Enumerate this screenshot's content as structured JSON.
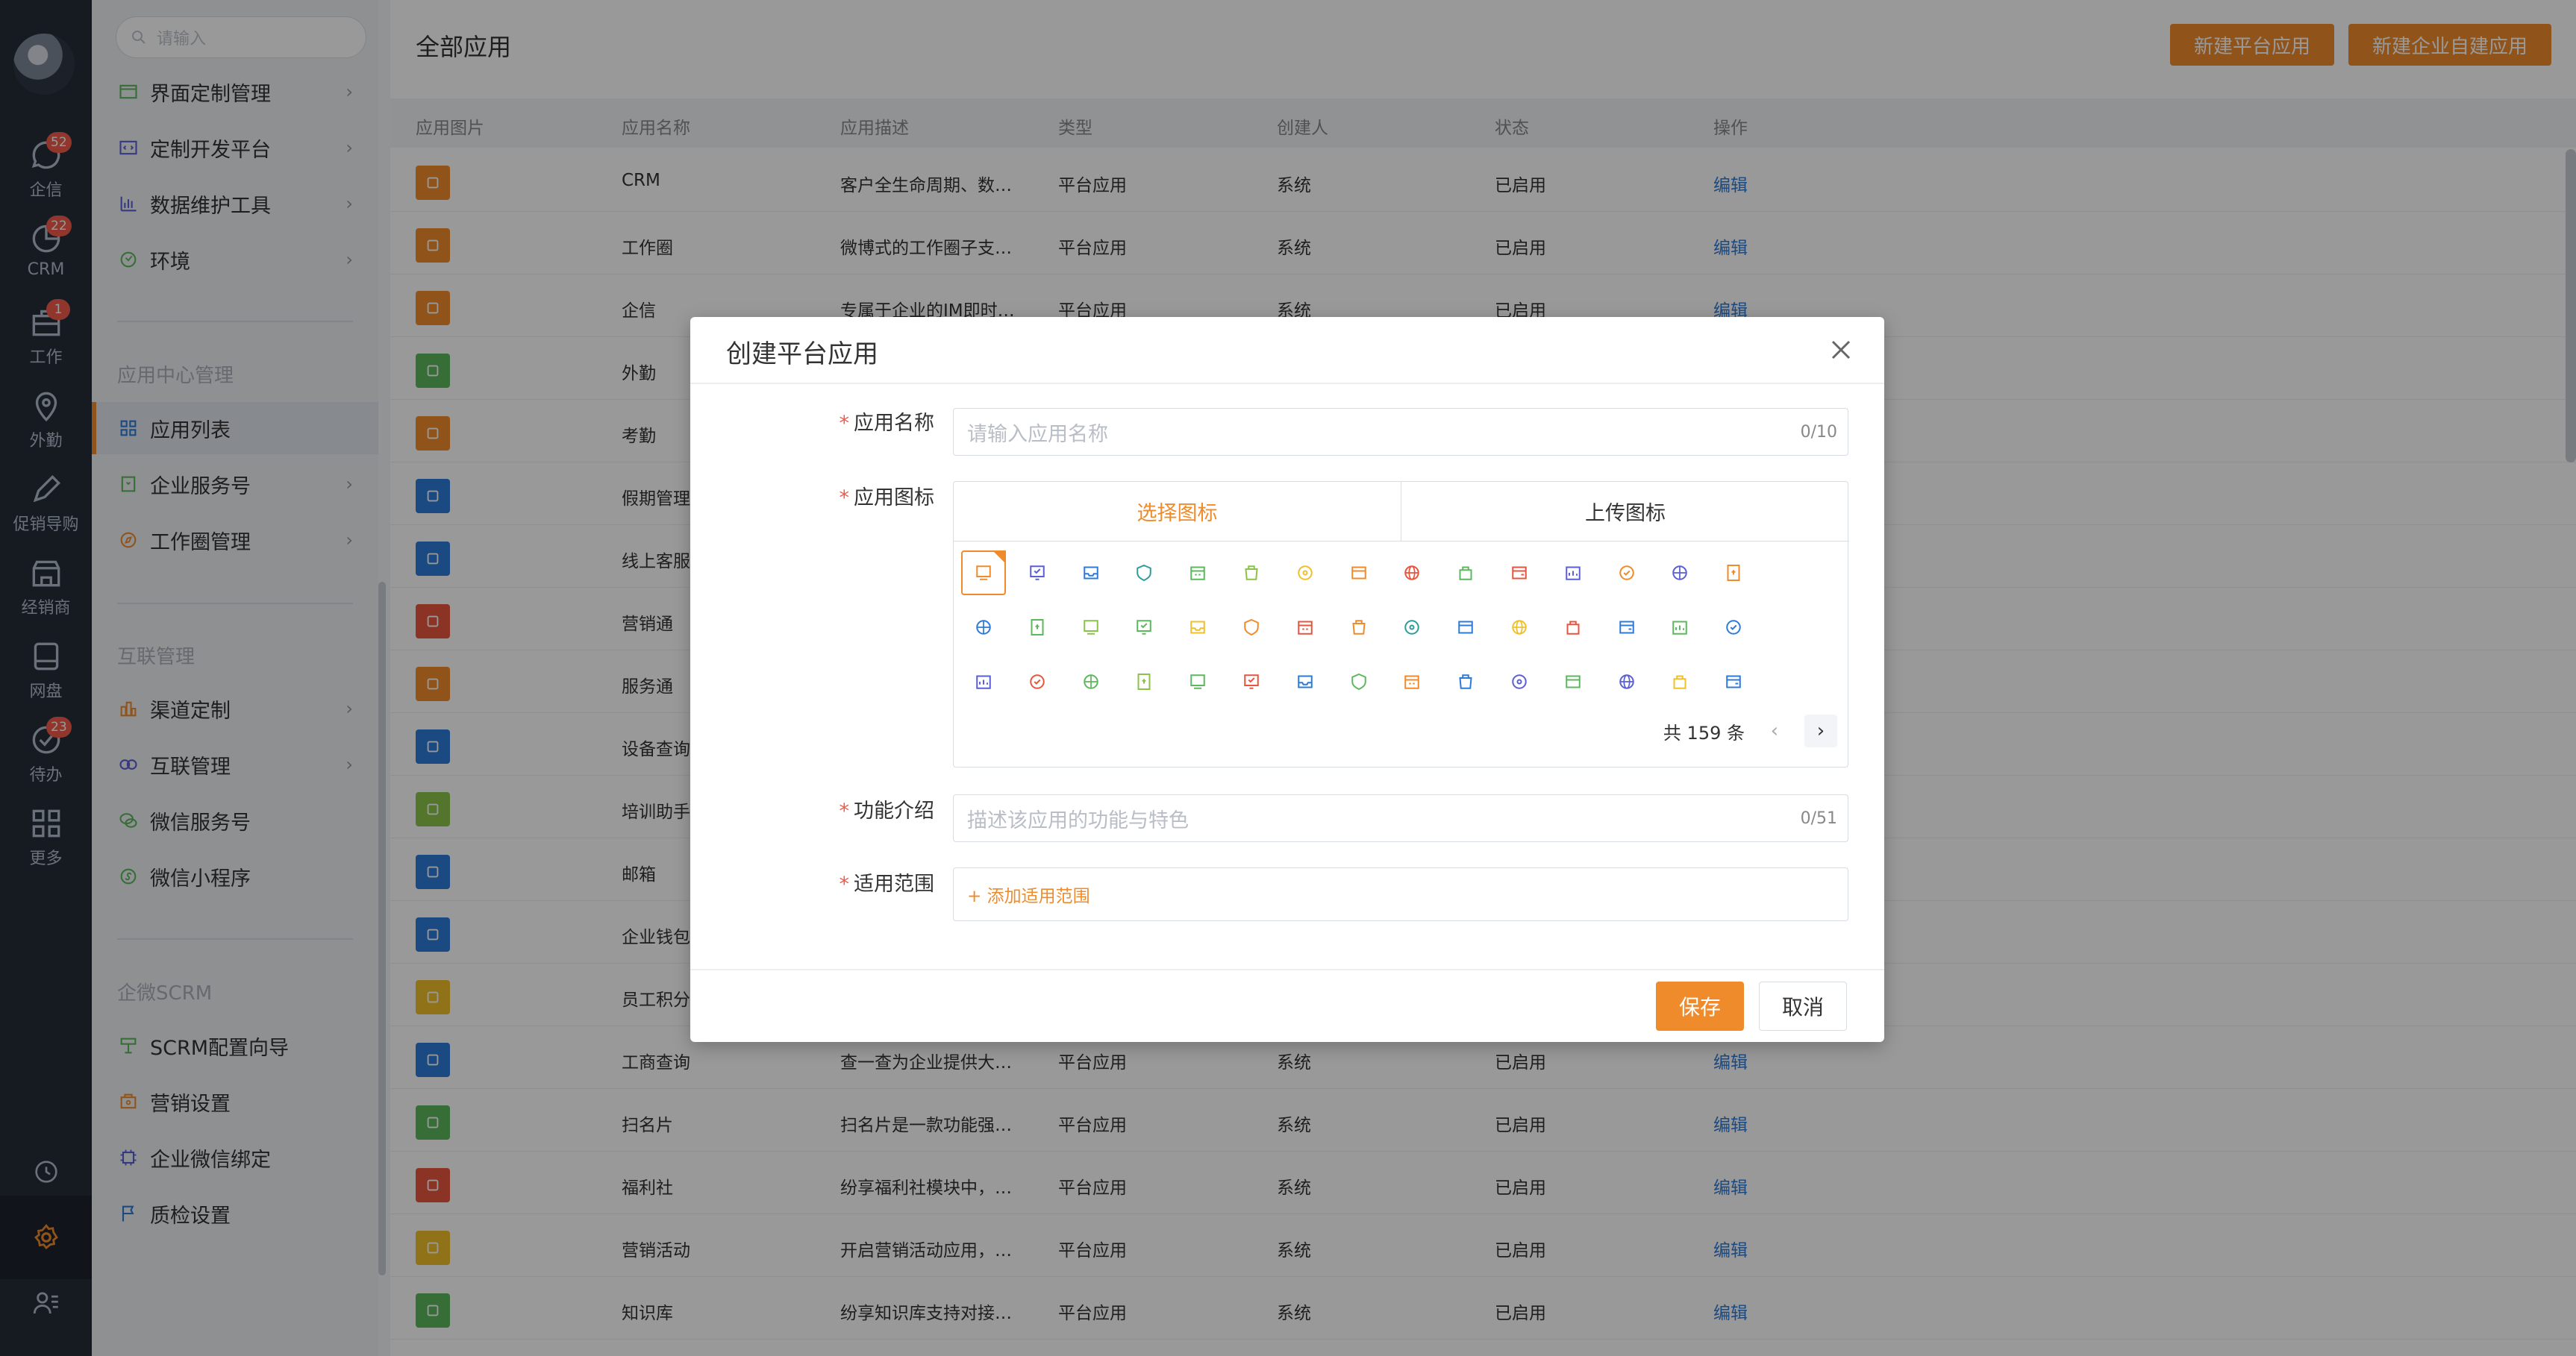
{
  "rail": {
    "items": [
      {
        "label": "企信",
        "badge": "52",
        "icon": "chat-icon"
      },
      {
        "label": "CRM",
        "badge": "22",
        "icon": "pie-icon"
      },
      {
        "label": "工作",
        "badge": "1",
        "icon": "briefcase-icon"
      },
      {
        "label": "外勤",
        "badge": "",
        "icon": "location-icon"
      },
      {
        "label": "促销导购",
        "badge": "",
        "icon": "pencil-icon"
      },
      {
        "label": "经销商",
        "badge": "",
        "icon": "store-icon"
      },
      {
        "label": "网盘",
        "badge": "",
        "icon": "disk-icon"
      },
      {
        "label": "待办",
        "badge": "23",
        "icon": "check-circle-icon"
      },
      {
        "label": "更多",
        "badge": "",
        "icon": "grid-icon"
      }
    ]
  },
  "sidebar": {
    "search_placeholder": "请输入",
    "group1": [
      {
        "label": "界面定制管理",
        "icon": "window-icon",
        "has_children": true
      },
      {
        "label": "定制开发平台",
        "icon": "code-icon",
        "has_children": true
      },
      {
        "label": "数据维护工具",
        "icon": "bar-chart-icon",
        "has_children": true
      },
      {
        "label": "环境",
        "icon": "environment-icon",
        "has_children": true
      }
    ],
    "section2": "应用中心管理",
    "group2": [
      {
        "label": "应用列表",
        "icon": "apps-icon",
        "has_children": false,
        "active": true
      },
      {
        "label": "企业服务号",
        "icon": "service-icon",
        "has_children": true
      },
      {
        "label": "工作圈管理",
        "icon": "compass-icon",
        "has_children": true
      }
    ],
    "section3": "互联管理",
    "group3": [
      {
        "label": "渠道定制",
        "icon": "channel-icon",
        "has_children": true
      },
      {
        "label": "互联管理",
        "icon": "link-icon",
        "has_children": true
      },
      {
        "label": "微信服务号",
        "icon": "wechat-icon",
        "has_children": false
      },
      {
        "label": "微信小程序",
        "icon": "miniprogram-icon",
        "has_children": false
      }
    ],
    "section4": "企微SCRM",
    "group4": [
      {
        "label": "SCRM配置向导",
        "icon": "guide-icon"
      },
      {
        "label": "营销设置",
        "icon": "marketing-icon"
      },
      {
        "label": "企业微信绑定",
        "icon": "chip-icon"
      },
      {
        "label": "质检设置",
        "icon": "flag-icon"
      }
    ],
    "collapse_glyph": "«"
  },
  "main": {
    "title": "全部应用",
    "btn_new_platform": "新建平台应用",
    "btn_new_enterprise": "新建企业自建应用",
    "columns": [
      "应用图片",
      "应用名称",
      "应用描述",
      "类型",
      "创建人",
      "状态",
      "操作"
    ],
    "rows": [
      {
        "name": "CRM",
        "desc": "客户全生命周期、数…",
        "type": "平台应用",
        "creator": "系统",
        "status": "已启用",
        "action": "编辑",
        "color": "#f08b2b"
      },
      {
        "name": "工作圈",
        "desc": "微博式的工作圈子支…",
        "type": "平台应用",
        "creator": "系统",
        "status": "已启用",
        "action": "编辑",
        "color": "#f08b2b"
      },
      {
        "name": "企信",
        "desc": "专属于企业的IM即时…",
        "type": "平台应用",
        "creator": "系统",
        "status": "已启用",
        "action": "编辑",
        "color": "#f08b2b"
      },
      {
        "name": "外勤",
        "desc": "",
        "type": "",
        "creator": "",
        "status": "",
        "action": "",
        "color": "#5cb85c"
      },
      {
        "name": "考勤",
        "desc": "",
        "type": "",
        "creator": "",
        "status": "",
        "action": "",
        "color": "#f08b2b"
      },
      {
        "name": "假期管理",
        "desc": "",
        "type": "",
        "creator": "",
        "status": "",
        "action": "",
        "color": "#2d7bd9"
      },
      {
        "name": "线上客服",
        "desc": "",
        "type": "",
        "creator": "",
        "status": "",
        "action": "",
        "color": "#2d7bd9"
      },
      {
        "name": "营销通",
        "desc": "",
        "type": "",
        "creator": "",
        "status": "",
        "action": "",
        "color": "#e8553e"
      },
      {
        "name": "服务通",
        "desc": "",
        "type": "",
        "creator": "",
        "status": "",
        "action": "",
        "color": "#f08b2b"
      },
      {
        "name": "设备查询",
        "desc": "",
        "type": "",
        "creator": "",
        "status": "",
        "action": "",
        "color": "#2d7bd9"
      },
      {
        "name": "培训助手",
        "desc": "",
        "type": "",
        "creator": "",
        "status": "",
        "action": "",
        "color": "#8bc34a"
      },
      {
        "name": "邮箱",
        "desc": "",
        "type": "",
        "creator": "",
        "status": "",
        "action": "",
        "color": "#2d7bd9"
      },
      {
        "name": "企业钱包",
        "desc": "",
        "type": "",
        "creator": "",
        "status": "",
        "action": "",
        "color": "#2d7bd9"
      },
      {
        "name": "员工积分",
        "desc": "",
        "type": "",
        "creator": "",
        "status": "",
        "action": "",
        "color": "#f0c02b"
      },
      {
        "name": "工商查询",
        "desc": "查一查为企业提供大…",
        "type": "平台应用",
        "creator": "系统",
        "status": "已启用",
        "action": "编辑",
        "color": "#2d7bd9"
      },
      {
        "name": "扫名片",
        "desc": "扫名片是一款功能强…",
        "type": "平台应用",
        "creator": "系统",
        "status": "已启用",
        "action": "编辑",
        "color": "#5cb85c"
      },
      {
        "name": "福利社",
        "desc": "纷享福利社模块中，…",
        "type": "平台应用",
        "creator": "系统",
        "status": "已启用",
        "action": "编辑",
        "color": "#e8553e"
      },
      {
        "name": "营销活动",
        "desc": "开启营销活动应用，…",
        "type": "平台应用",
        "creator": "系统",
        "status": "已启用",
        "action": "编辑",
        "color": "#f0c02b"
      },
      {
        "name": "知识库",
        "desc": "纷享知识库支持对接…",
        "type": "平台应用",
        "creator": "系统",
        "status": "已启用",
        "action": "编辑",
        "color": "#5cb85c"
      }
    ]
  },
  "modal": {
    "title": "创建平台应用",
    "name_label": "应用名称",
    "name_placeholder": "请输入应用名称",
    "name_count": "0/10",
    "icon_label": "应用图标",
    "tab_choose": "选择图标",
    "tab_upload": "上传图标",
    "total_text": "共 159 条",
    "prev_glyph": "‹",
    "next_glyph": "›",
    "intro_label": "功能介绍",
    "intro_placeholder": "描述该应用的功能与特色",
    "intro_count": "0/51",
    "scope_label": "适用范围",
    "scope_add": "+ 添加适用范围",
    "save": "保存",
    "cancel": "取消",
    "icon_colors": [
      "#f08b2b",
      "#5b5fd6",
      "#2d7bd9",
      "#2d9c9c",
      "#5cb85c",
      "#8bc34a",
      "#f0c02b",
      "#f08b2b",
      "#e8553e",
      "#5cb85c",
      "#e8553e",
      "#5b5fd6",
      "#f08b2b",
      "#5b5fd6",
      "#f08b2b",
      "#2d7bd9",
      "#5cb85c",
      "#8bc34a",
      "#5cb85c",
      "#f0c02b",
      "#f08b2b",
      "#e8553e",
      "#f08b2b",
      "#2d9c9c",
      "#2d7bd9",
      "#f0c02b",
      "#e8553e",
      "#2d7bd9",
      "#5cb85c",
      "#2d7bd9",
      "#5b5fd6",
      "#e8553e",
      "#5cb85c",
      "#8bc34a",
      "#5cb85c",
      "#e8553e",
      "#2d7bd9",
      "#5cb85c",
      "#f08b2b",
      "#2d7bd9",
      "#5b5fd6",
      "#5cb85c",
      "#5b5fd6",
      "#f0c02b",
      "#2d7bd9"
    ]
  }
}
